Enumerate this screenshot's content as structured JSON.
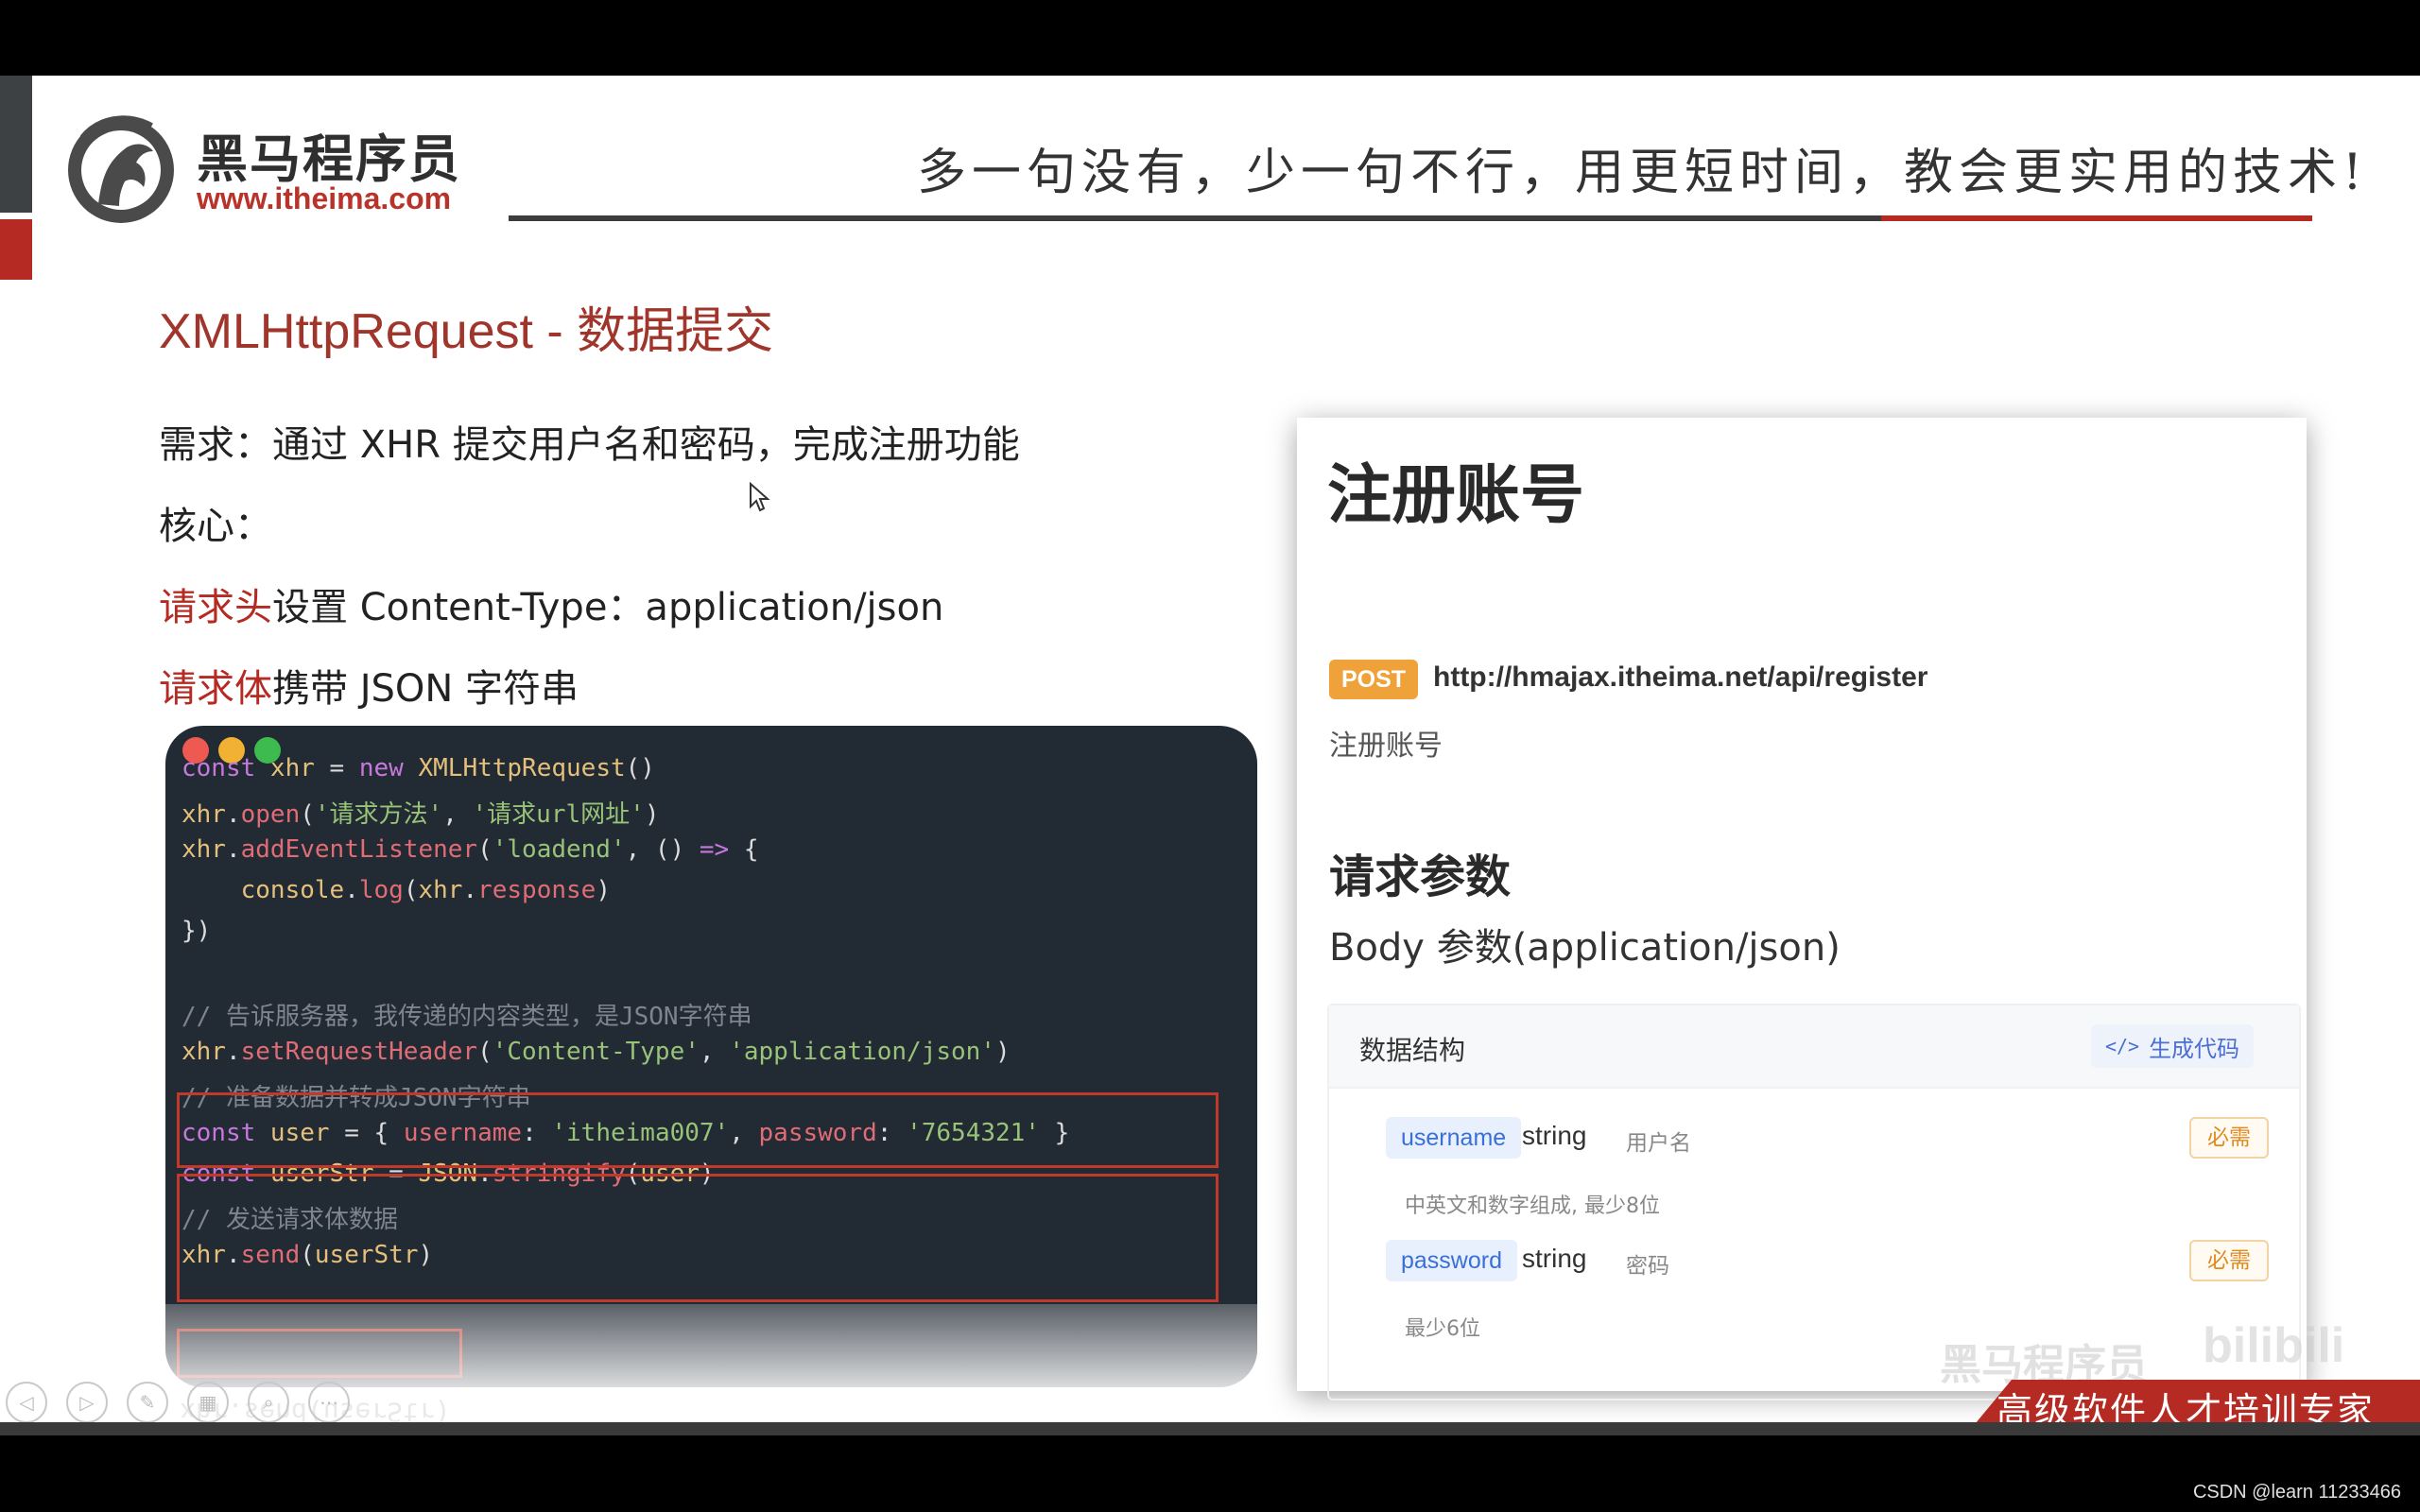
{
  "header": {
    "logo_cn": "黑马程序员",
    "logo_url": "www.itheima.com",
    "slogan": "多一句没有，少一句不行，用更短时间，教会更实用的技术!"
  },
  "slide": {
    "title": "XMLHttpRequest - 数据提交",
    "req_line": "需求：通过 XHR 提交用户名和密码，完成注册功能",
    "core_line": "核心：",
    "header_red": "请求头",
    "header_rest": "设置 Content-Type：application/json",
    "body_red": "请求体",
    "body_rest": "携带 JSON 字符串"
  },
  "code": {
    "l1": {
      "a": "const ",
      "b": "xhr",
      "c": " = ",
      "d": "new ",
      "e": "XMLHttpRequest",
      "f": "()"
    },
    "l2": {
      "a": "xhr",
      "b": ".",
      "c": "open",
      "d": "(",
      "e": "'请求方法'",
      "f": ", ",
      "g": "'请求url网址'",
      "h": ")"
    },
    "l3": {
      "a": "xhr",
      "b": ".",
      "c": "addEventListener",
      "d": "(",
      "e": "'loadend'",
      "f": ", () ",
      "g": "=>",
      "h": " {"
    },
    "l4": {
      "a": "    console",
      "b": ".",
      "c": "log",
      "d": "(",
      "e": "xhr",
      "f": ".",
      "g": "response",
      "h": ")"
    },
    "l5": "})",
    "l6": "// 告诉服务器，我传递的内容类型，是JSON字符串",
    "l7": {
      "a": "xhr",
      "b": ".",
      "c": "setRequestHeader",
      "d": "(",
      "e": "'Content-Type'",
      "f": ", ",
      "g": "'application/json'",
      "h": ")"
    },
    "l8": "// 准备数据并转成JSON字符串",
    "l9": {
      "a": "const ",
      "b": "user",
      "c": " = { ",
      "d": "username",
      "e": ": ",
      "f": "'itheima007'",
      "g": ", ",
      "h": "password",
      "i": ": ",
      "j": "'7654321'",
      "k": " }"
    },
    "l10": {
      "a": "const ",
      "b": "userStr",
      "c": " = ",
      "d": "JSON",
      "e": ".",
      "f": "stringify",
      "g": "(",
      "h": "user",
      "i": ")"
    },
    "l11": "// 发送请求体数据",
    "l12": {
      "a": "xhr",
      "b": ".",
      "c": "send",
      "d": "(",
      "e": "userStr",
      "f": ")"
    },
    "reflection": "xhr.send(userStr)"
  },
  "api": {
    "title": "注册账号",
    "method": "POST",
    "url": "http://hmajax.itheima.net/api/register",
    "subtitle": "注册账号",
    "params_title": "请求参数",
    "body_label": "Body 参数(application/json)",
    "struct_label": "数据结构",
    "gen_code": "生成代码",
    "fields": [
      {
        "name": "username",
        "type": "string",
        "label": "用户名",
        "desc": "中英文和数字组成, 最少8位",
        "required": "必需"
      },
      {
        "name": "password",
        "type": "string",
        "label": "密码",
        "desc": "最少6位",
        "required": "必需"
      }
    ]
  },
  "footer": {
    "watermark": "黑马程序员",
    "bili": "bilibili",
    "banner": "高级软件人才培训专家",
    "csdn": "CSDN @learn 11233466"
  },
  "colors": {
    "brand_red": "#b52a22",
    "code_bg": "#222a33",
    "post_orange": "#f0a23a"
  }
}
